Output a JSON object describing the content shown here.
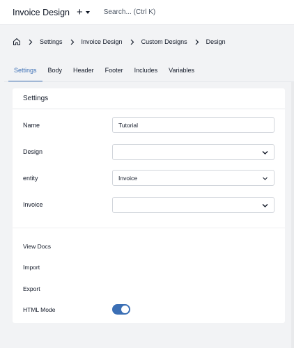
{
  "topbar": {
    "title": "Invoice Design",
    "add_label": "+",
    "search_placeholder": "Search... (Ctrl K)"
  },
  "breadcrumb": {
    "items": [
      "Settings",
      "Invoice Design",
      "Custom Designs",
      "Design"
    ]
  },
  "tabs": [
    {
      "label": "Settings",
      "active": true
    },
    {
      "label": "Body",
      "active": false
    },
    {
      "label": "Header",
      "active": false
    },
    {
      "label": "Footer",
      "active": false
    },
    {
      "label": "Includes",
      "active": false
    },
    {
      "label": "Variables",
      "active": false
    }
  ],
  "card": {
    "title": "Settings",
    "fields": {
      "name": {
        "label": "Name",
        "value": "Tutorial"
      },
      "design": {
        "label": "Design",
        "value": ""
      },
      "entity": {
        "label": "entity",
        "value": "Invoice"
      },
      "invoice": {
        "label": "Invoice",
        "value": ""
      }
    },
    "links": {
      "view_docs": "View Docs",
      "import": "Import",
      "export": "Export",
      "html_mode": "HTML Mode"
    },
    "html_mode_enabled": true
  },
  "colors": {
    "accent": "#3b6fb5",
    "page_bg": "#f2f3f5",
    "card_bg": "#ffffff"
  }
}
